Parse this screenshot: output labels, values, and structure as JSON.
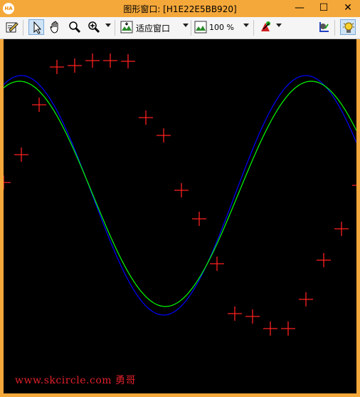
{
  "window": {
    "title": "图形窗口: [H1E22E5BB920]",
    "app_icon_text": "HA"
  },
  "controls": {
    "minimize": "—",
    "maximize": "☐",
    "close": "✕"
  },
  "toolbar": {
    "fit_label": "适应窗口",
    "zoom_label": "100 %",
    "icons": [
      "edit-icon",
      "pointer-icon",
      "hand-pan-icon",
      "magnifier-icon",
      "zoom-in-icon",
      "fit-window-icon",
      "zoom-percent-icon",
      "paint-color-icon",
      "axis-icon",
      "lightbulb-icon"
    ]
  },
  "canvas": {
    "background": "#000000",
    "watermark": "www.skcircle.com 勇哥"
  },
  "chart_data": {
    "type": "line",
    "series": [
      {
        "color": "#ff2020",
        "style": "cross-markers",
        "points": [
          [
            0,
            201
          ],
          [
            25,
            162
          ],
          [
            50,
            92
          ],
          [
            75,
            39
          ],
          [
            100,
            37
          ],
          [
            125,
            30
          ],
          [
            150,
            30
          ],
          [
            175,
            31
          ],
          [
            200,
            110
          ],
          [
            225,
            135
          ],
          [
            250,
            212
          ],
          [
            275,
            252
          ],
          [
            300,
            315
          ],
          [
            325,
            385
          ],
          [
            350,
            389
          ],
          [
            375,
            406
          ],
          [
            400,
            406
          ],
          [
            425,
            365
          ],
          [
            450,
            310
          ],
          [
            475,
            266
          ],
          [
            500,
            205
          ]
        ]
      },
      {
        "color": "#0000ff",
        "style": "line",
        "points": "fitted-curve-a"
      },
      {
        "color": "#00ff00",
        "style": "line",
        "points": "fitted-curve-b"
      }
    ]
  }
}
